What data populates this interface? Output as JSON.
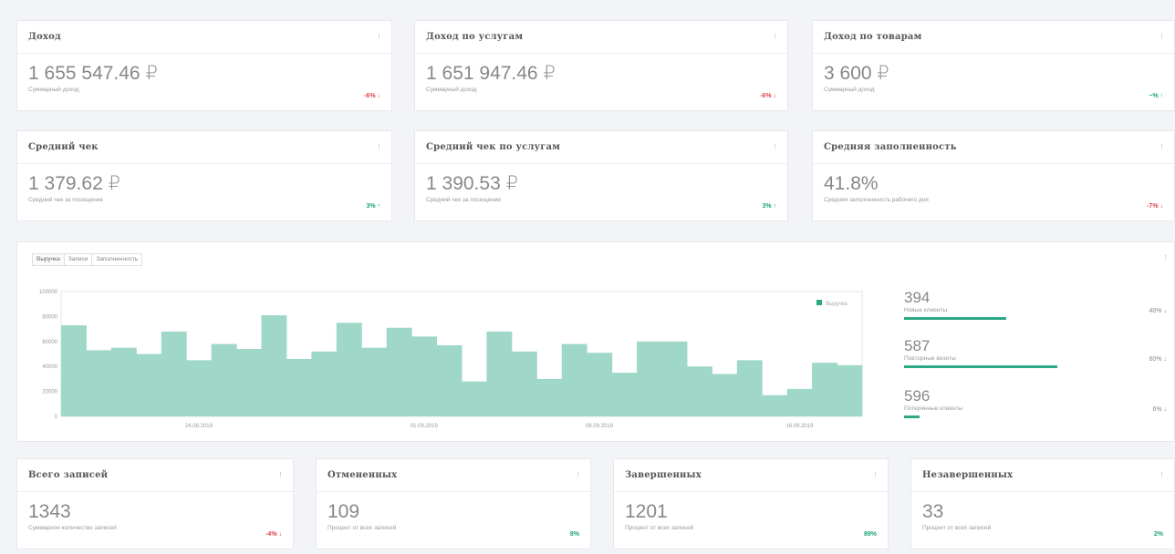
{
  "top_cards": [
    {
      "title": "Доход",
      "menu": "⁝",
      "value": "1 655 547.46 ₽",
      "sub": "Суммарный доход",
      "delta": "-6% ↓",
      "delta_type": "neg"
    },
    {
      "title": "Доход по услугам",
      "menu": "⁝",
      "value": "1 651 947.46 ₽",
      "sub": "Суммарный доход",
      "delta": "-6% ↓",
      "delta_type": "neg"
    },
    {
      "title": "Доход по товарам",
      "menu": "⁝",
      "value": "3 600 ₽",
      "sub": "Суммарный доход",
      "delta": "~% ↑",
      "delta_type": "pos"
    },
    {
      "title": "Средний чек",
      "menu": "⁝",
      "value": "1 379.62 ₽",
      "sub": "Средний чек за посещение",
      "delta": "3% ↑",
      "delta_type": "pos"
    },
    {
      "title": "Средний чек по услугам",
      "menu": "⁝",
      "value": "1 390.53 ₽",
      "sub": "Средний чек за посещение",
      "delta": "3% ↑",
      "delta_type": "pos"
    },
    {
      "title": "Средняя заполненность",
      "menu": "⁝",
      "value": "41.8%",
      "sub": "Средняя заполненность рабочего дня",
      "delta": "-7% ↓",
      "delta_type": "neg"
    }
  ],
  "chart_tabs": [
    "Выручка",
    "Записи",
    "Заполненность"
  ],
  "chart_menu": "⁝",
  "chart_data": {
    "type": "bar",
    "ylim": [
      0,
      100000
    ],
    "yticks": [
      "100000",
      "80000",
      "60000",
      "40000",
      "20000",
      "0"
    ],
    "xticks": [
      "24.08.2019",
      "01.09.2019",
      "08.09.2019",
      "16.09.2019"
    ],
    "legend": "Выручка",
    "values": [
      73000,
      53000,
      55000,
      50000,
      68000,
      45000,
      58000,
      54000,
      81000,
      46000,
      52000,
      75000,
      55000,
      71000,
      64000,
      57000,
      28000,
      68000,
      52000,
      30000,
      58000,
      51000,
      35000,
      60000,
      60000,
      40000,
      34000,
      45000,
      17000,
      22000,
      43000,
      41000
    ],
    "bar_color": "#9fd8c8"
  },
  "stats": [
    {
      "value": "394",
      "label": "Новые клиенты",
      "pct": "40% ↓",
      "fill": 0.4
    },
    {
      "value": "587",
      "label": "Повторные визиты",
      "pct": "60% ↓",
      "fill": 0.6
    },
    {
      "value": "596",
      "label": "Потерянные клиенты",
      "pct": "6% ↓",
      "fill": 0.06
    }
  ],
  "bottom_cards": [
    {
      "title": "Всего записей",
      "menu": "⁝",
      "value": "1343",
      "sub": "Суммарное количество записей",
      "delta": "-4% ↓",
      "delta_type": "neg"
    },
    {
      "title": "Отмененных",
      "menu": "⁝",
      "value": "109",
      "sub": "Процент от всех записей",
      "delta": "8%",
      "delta_type": "pos"
    },
    {
      "title": "Завершенных",
      "menu": "⁝",
      "value": "1201",
      "sub": "Процент от всех записей",
      "delta": "89%",
      "delta_type": "pos"
    },
    {
      "title": "Незавершенных",
      "menu": "⁝",
      "value": "33",
      "sub": "Процент от всех записей",
      "delta": "2%",
      "delta_type": "pos"
    }
  ]
}
